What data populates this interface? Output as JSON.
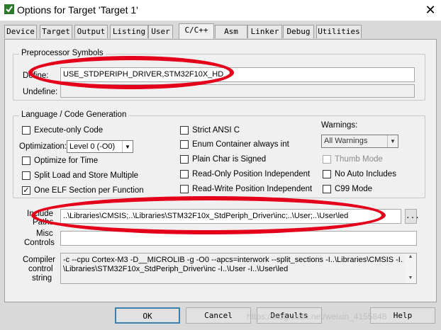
{
  "window": {
    "title": "Options for Target 'Target 1'",
    "close": "✕"
  },
  "tabs": [
    {
      "label": "Device"
    },
    {
      "label": "Target"
    },
    {
      "label": "Output"
    },
    {
      "label": "Listing"
    },
    {
      "label": "User"
    },
    {
      "label": "C/C++"
    },
    {
      "label": "Asm"
    },
    {
      "label": "Linker"
    },
    {
      "label": "Debug"
    },
    {
      "label": "Utilities"
    }
  ],
  "active_tab": "C/C++",
  "preprocessor": {
    "group_label": "Preprocessor Symbols",
    "define_label": "Define:",
    "define_value": "USE_STDPERIPH_DRIVER,STM32F10X_HD",
    "undefine_label": "Undefine:",
    "undefine_value": ""
  },
  "language": {
    "group_label": "Language / Code Generation",
    "execute_only": {
      "label": "Execute-only Code",
      "checked": false
    },
    "optimization_label": "Optimization:",
    "optimization_value": "Level 0 (-O0)",
    "optimize_time": {
      "label": "Optimize for Time",
      "checked": false
    },
    "split_load_store": {
      "label": "Split Load and Store Multiple",
      "checked": false
    },
    "one_elf": {
      "label": "One ELF Section per Function",
      "checked": true,
      "mark": "✓"
    },
    "strict_ansi": {
      "label": "Strict ANSI C",
      "checked": false
    },
    "enum_container": {
      "label": "Enum Container always int",
      "checked": false
    },
    "plain_char": {
      "label": "Plain Char is Signed",
      "checked": false
    },
    "ro_pi": {
      "label": "Read-Only Position Independent",
      "checked": false
    },
    "rw_pi": {
      "label": "Read-Write Position Independent",
      "checked": false
    },
    "warnings_label": "Warnings:",
    "warnings_value": "All Warnings",
    "thumb_mode": {
      "label": "Thumb Mode",
      "checked": false
    },
    "no_auto_includes": {
      "label": "No Auto Includes",
      "checked": false
    },
    "c99_mode": {
      "label": "C99 Mode",
      "checked": false
    }
  },
  "include": {
    "label_line1": "Include",
    "label_line2": "Paths",
    "value": "..\\Libraries\\CMSIS;..\\Libraries\\STM32F10x_StdPeriph_Driver\\inc;..\\User;..\\User\\led",
    "browse": "..."
  },
  "misc": {
    "label_line1": "Misc",
    "label_line2": "Controls",
    "value": ""
  },
  "compiler": {
    "label_line1": "Compiler",
    "label_line2": "control",
    "label_line3": "string",
    "line1": "-c --cpu Cortex-M3 -D__MICROLIB -g -O0 --apcs=interwork --split_sections -I..\\Libraries\\CMSIS -I..",
    "line2": "\\Libraries\\STM32F10x_StdPeriph_Driver\\inc -I..\\User -I..\\User\\led"
  },
  "buttons": {
    "ok": "OK",
    "cancel": "Cancel",
    "defaults": "Defaults",
    "help": "Help"
  },
  "watermark": "https://blog.csdn.net/weixin_4155848",
  "colors": {
    "annotation": "#e4001b",
    "app_icon": "#2a7a2a"
  }
}
